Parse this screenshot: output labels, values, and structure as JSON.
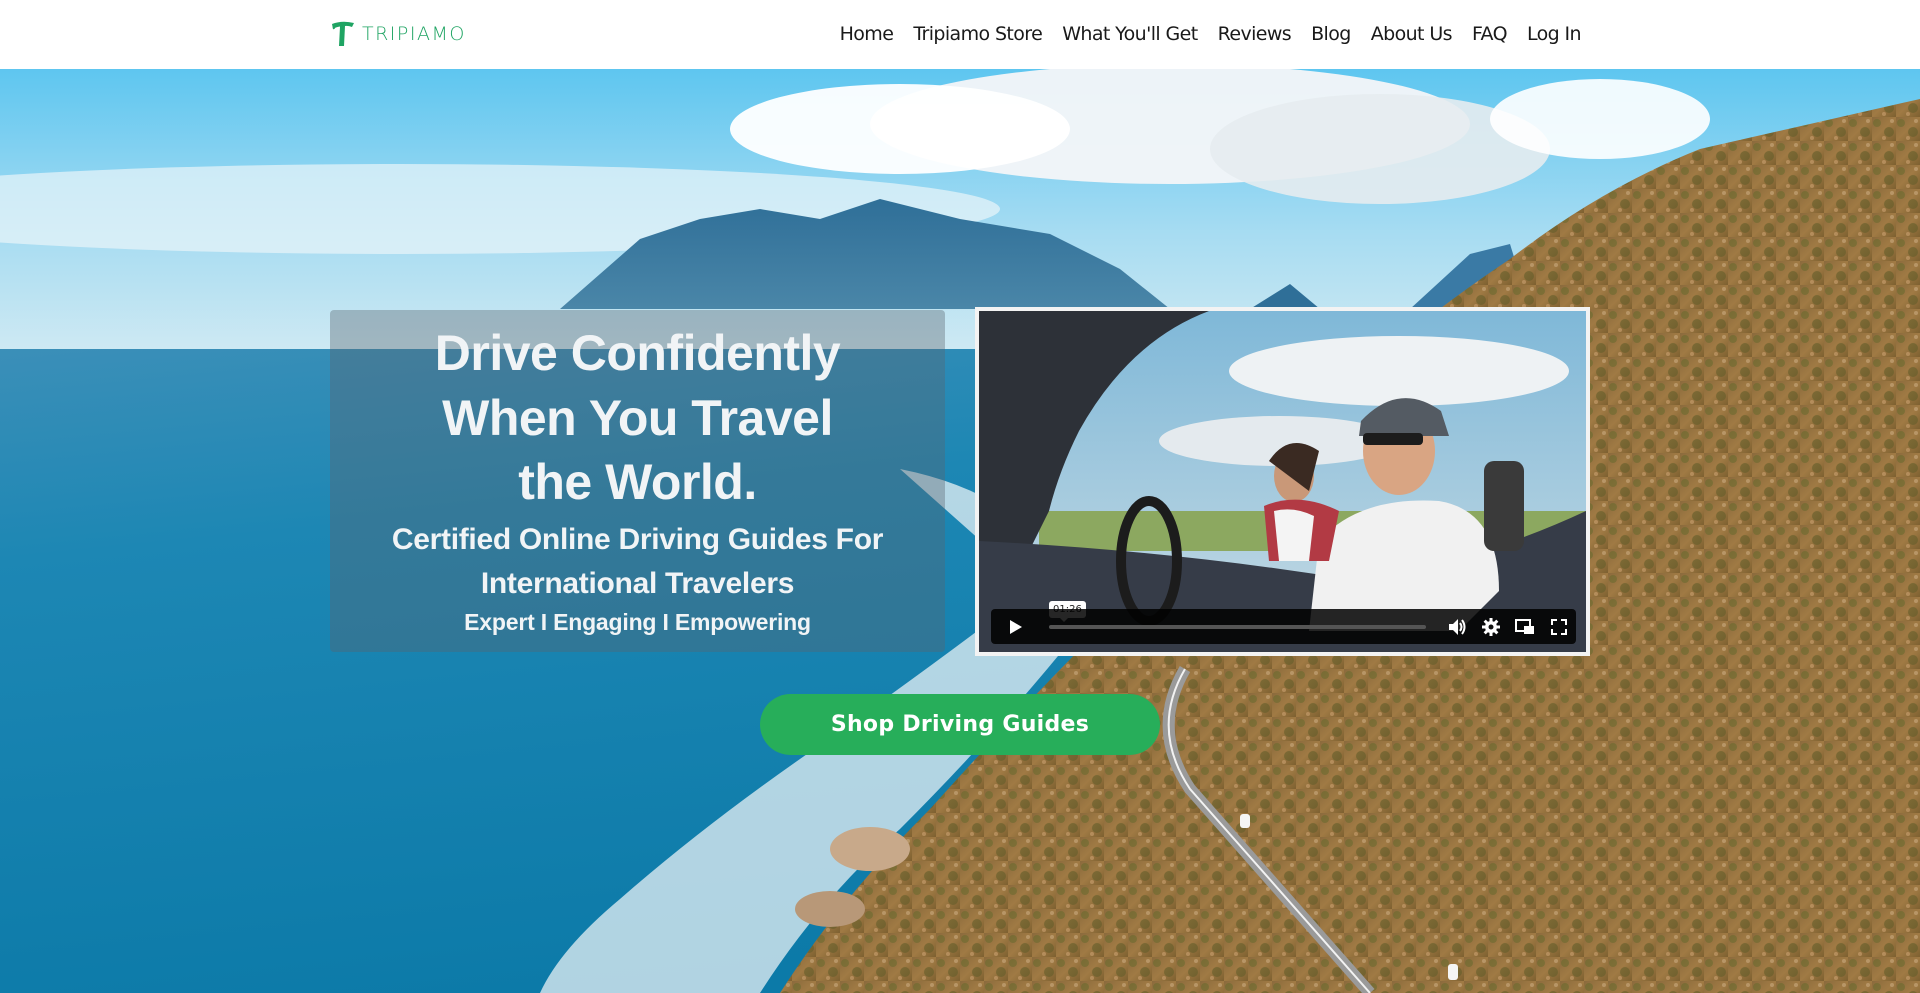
{
  "header": {
    "logo_text": "TRIPIAMO",
    "logo_icon": "tripiamo-t-logo-icon",
    "brand_color": "#1fa463",
    "nav": [
      {
        "label": "Home"
      },
      {
        "label": "Tripiamo Store"
      },
      {
        "label": "What You'll Get"
      },
      {
        "label": "Reviews"
      },
      {
        "label": "Blog"
      },
      {
        "label": "About Us"
      },
      {
        "label": "FAQ"
      },
      {
        "label": "Log In"
      }
    ]
  },
  "hero": {
    "background": "aerial coastal road with ocean, mountains and cliffs",
    "headline_line1": "Drive Confidently",
    "headline_line2": "When You Travel the World.",
    "subheadline": "Certified Online Driving Guides For International Travelers",
    "tagline": "Expert I Engaging I Empowering",
    "cta_label": "Shop Driving Guides",
    "cta_color": "#27ae5a"
  },
  "video": {
    "description": "couple driving a convertible",
    "hover_time": "01:26",
    "progress_fraction": 0.0,
    "controls": {
      "play": "play-icon",
      "volume": "volume-icon",
      "settings": "gear-icon",
      "pip": "picture-in-picture-icon",
      "fullscreen": "fullscreen-icon"
    }
  }
}
